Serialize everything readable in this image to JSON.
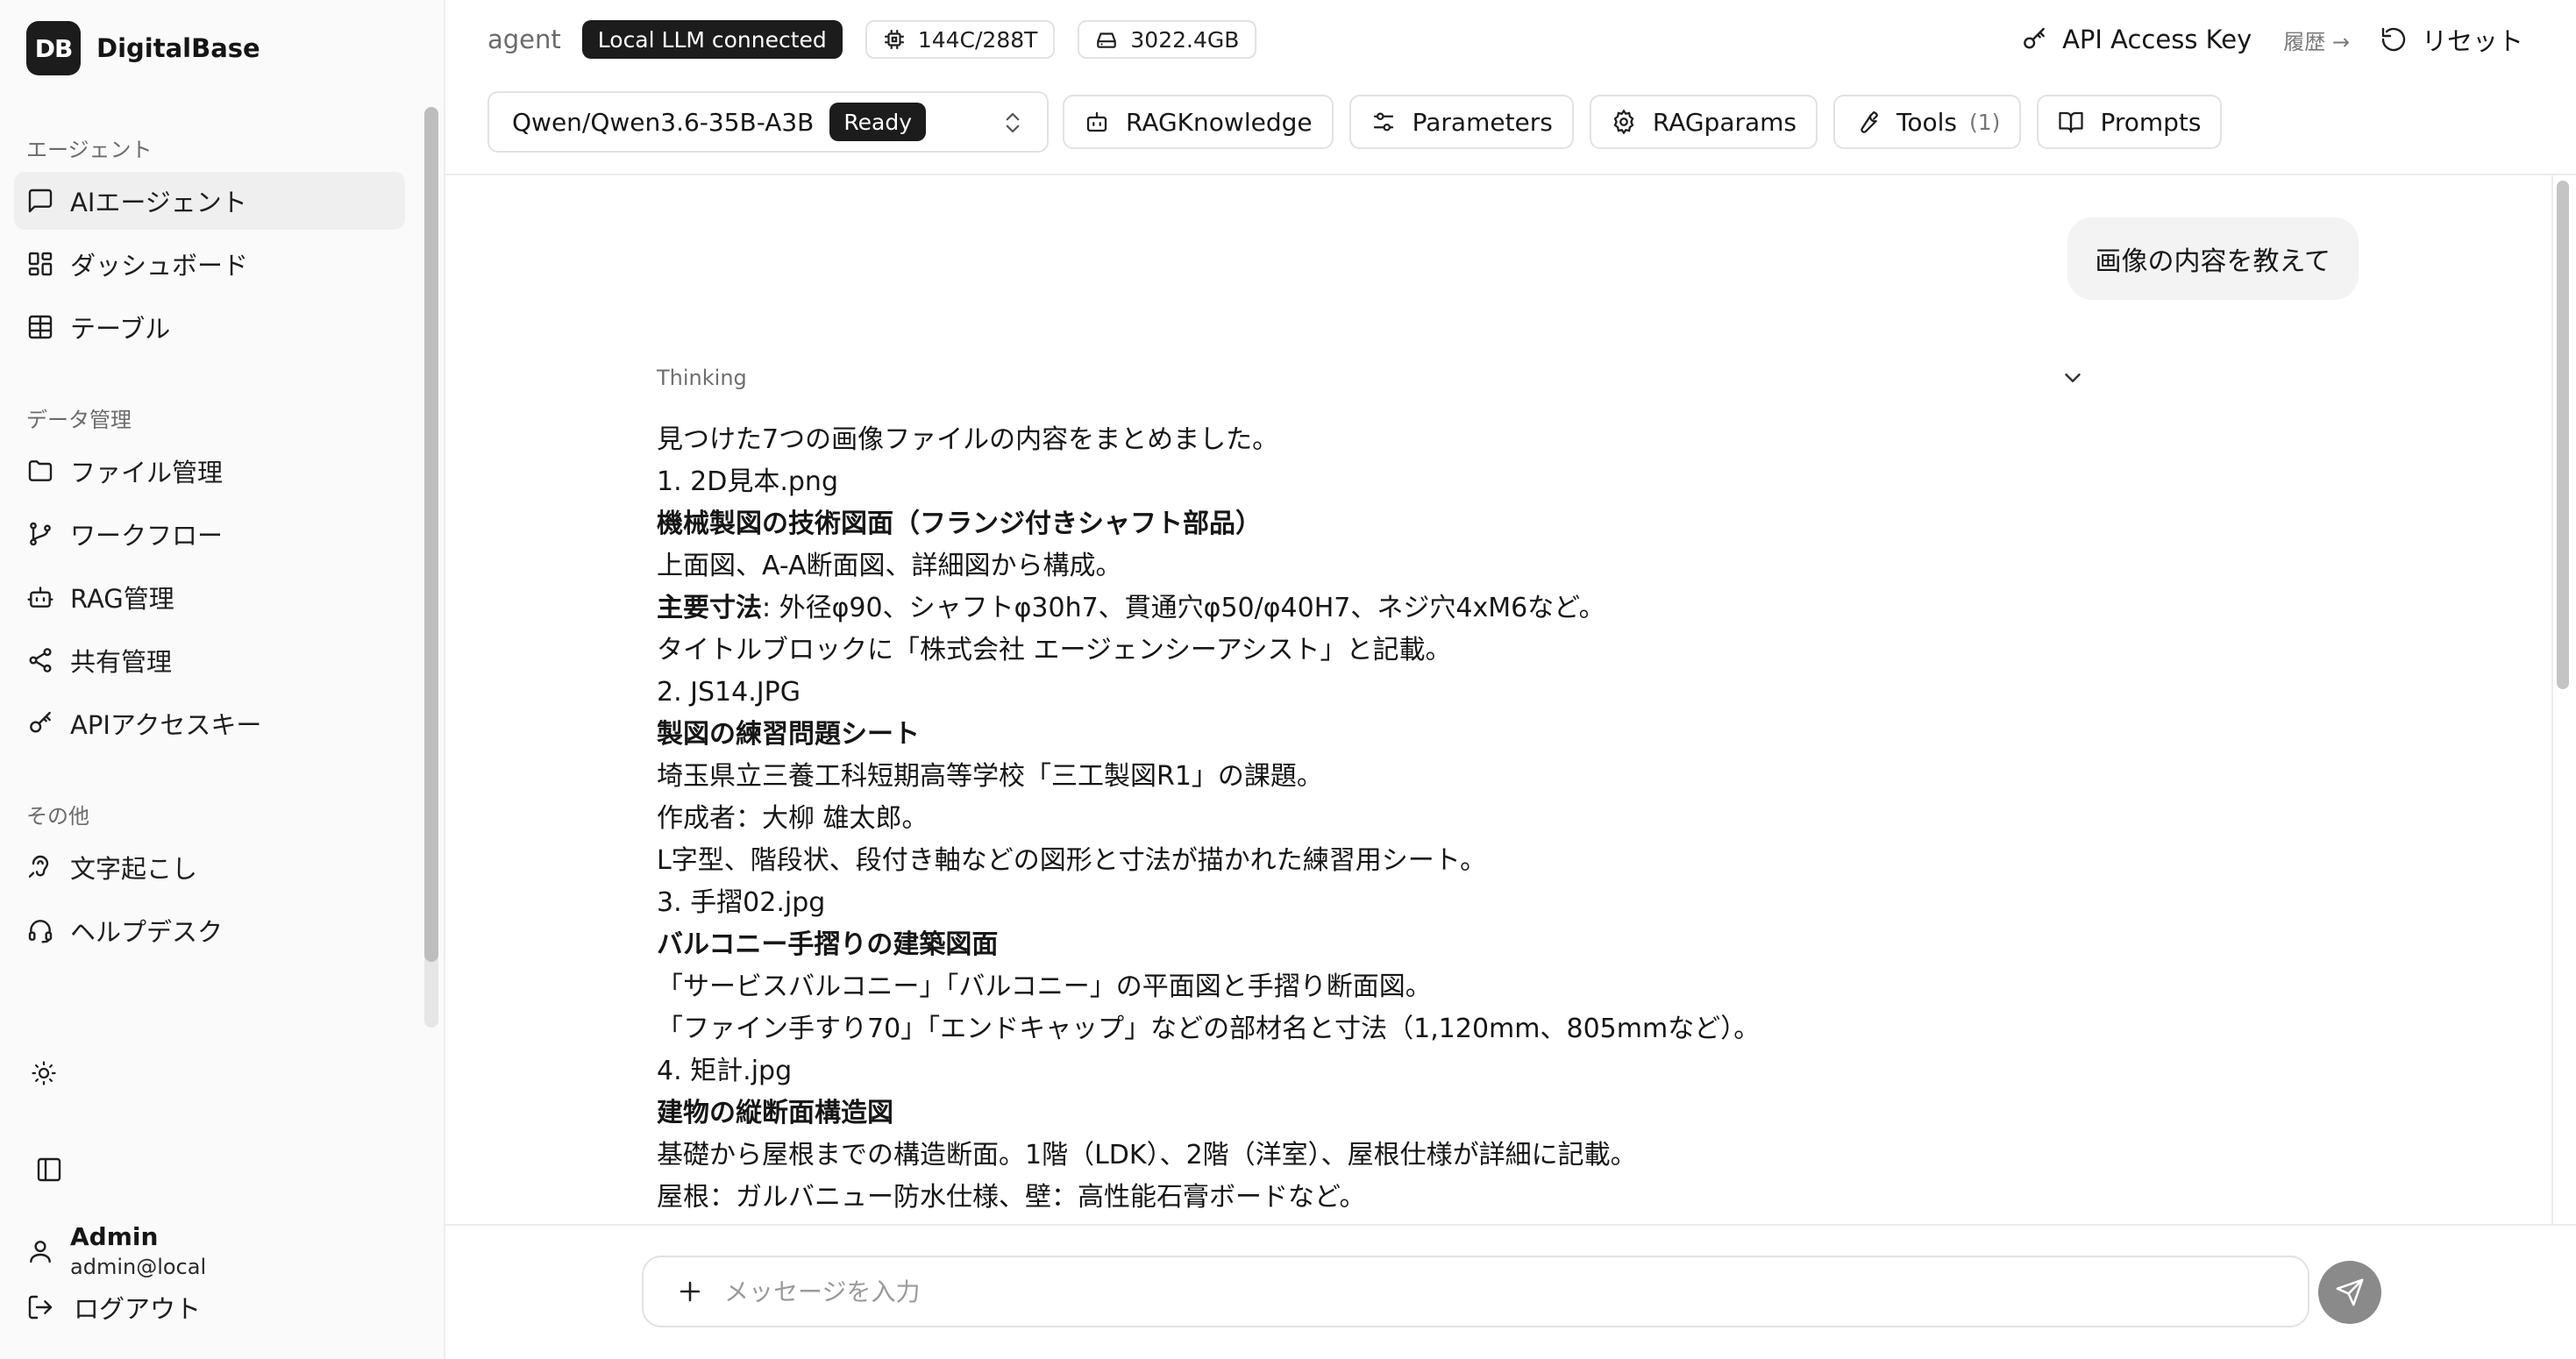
{
  "brand": {
    "logo": "DB",
    "name": "DigitalBase"
  },
  "sidebar": {
    "sections": [
      {
        "label": "エージェント",
        "items": [
          {
            "label": "AIエージェント",
            "icon": "message-square-icon",
            "active": true
          },
          {
            "label": "ダッシュボード",
            "icon": "layout-grid-icon"
          },
          {
            "label": "テーブル",
            "icon": "table-icon"
          }
        ]
      },
      {
        "label": "データ管理",
        "items": [
          {
            "label": "ファイル管理",
            "icon": "folder-icon"
          },
          {
            "label": "ワークフロー",
            "icon": "git-branch-icon"
          },
          {
            "label": "RAG管理",
            "icon": "bot-icon"
          },
          {
            "label": "共有管理",
            "icon": "share-icon"
          },
          {
            "label": "APIアクセスキー",
            "icon": "key-icon"
          }
        ]
      },
      {
        "label": "その他",
        "items": [
          {
            "label": "文字起こし",
            "icon": "audio-transcribe-icon"
          },
          {
            "label": "ヘルプデスク",
            "icon": "headset-icon"
          }
        ]
      }
    ],
    "user": {
      "name": "Admin",
      "email": "admin@local"
    },
    "logout": "ログアウト"
  },
  "topbar": {
    "agent_label": "agent",
    "llm_status": "Local LLM connected",
    "cpu": "144C/288T",
    "storage": "3022.4GB",
    "api_key": "API Access Key",
    "history": "履歴 →",
    "reset": "リセット",
    "model": "Qwen/Qwen3.6-35B-A3B",
    "model_status": "Ready",
    "buttons": {
      "rag_knowledge": "RAGKnowledge",
      "parameters": "Parameters",
      "rag_params": "RAGparams",
      "tools": "Tools",
      "tools_count": "(1)",
      "prompts": "Prompts"
    }
  },
  "chat": {
    "user_message": "画像の内容を教えて",
    "thinking_label": "Thinking",
    "answer_lines": [
      {
        "text": "見つけた7つの画像ファイルの内容をまとめました。"
      },
      {
        "text": "1. 2D見本.png"
      },
      {
        "text": "機械製図の技術図面（フランジ付きシャフト部品）",
        "bold": true
      },
      {
        "text": "上面図、A-A断面図、詳細図から構成。"
      },
      {
        "bold_prefix": "主要寸法",
        "text": ": 外径φ90、シャフトφ30h7、貫通穴φ50/φ40H7、ネジ穴4xM6など。"
      },
      {
        "text": "タイトルブロックに「株式会社 エージェンシーアシスト」と記載。"
      },
      {
        "text": "2. JS14.JPG"
      },
      {
        "text": "製図の練習問題シート",
        "bold": true
      },
      {
        "text": "埼玉県立三養工科短期高等学校「三工製図R1」の課題。"
      },
      {
        "text": "作成者：大柳 雄太郎。"
      },
      {
        "text": "L字型、階段状、段付き軸などの図形と寸法が描かれた練習用シート。"
      },
      {
        "text": "3. 手摺02.jpg"
      },
      {
        "text": "バルコニー手摺りの建築図面",
        "bold": true
      },
      {
        "text": "「サービスバルコニー」「バルコニー」の平面図と手摺り断面図。"
      },
      {
        "text": "「ファイン手すり70」「エンドキャップ」などの部材名と寸法（1,120mm、805mmなど）。"
      },
      {
        "text": "4. 矩計.jpg"
      },
      {
        "text": "建物の縦断面構造図",
        "bold": true
      },
      {
        "text": "基礎から屋根までの構造断面。1階（LDK）、2階（洋室）、屋根仕様が詳細に記載。"
      },
      {
        "text": "屋根：ガルバニュー防水仕様、壁：高性能石膏ボードなど。"
      }
    ]
  },
  "composer": {
    "placeholder": "メッセージを入力"
  }
}
